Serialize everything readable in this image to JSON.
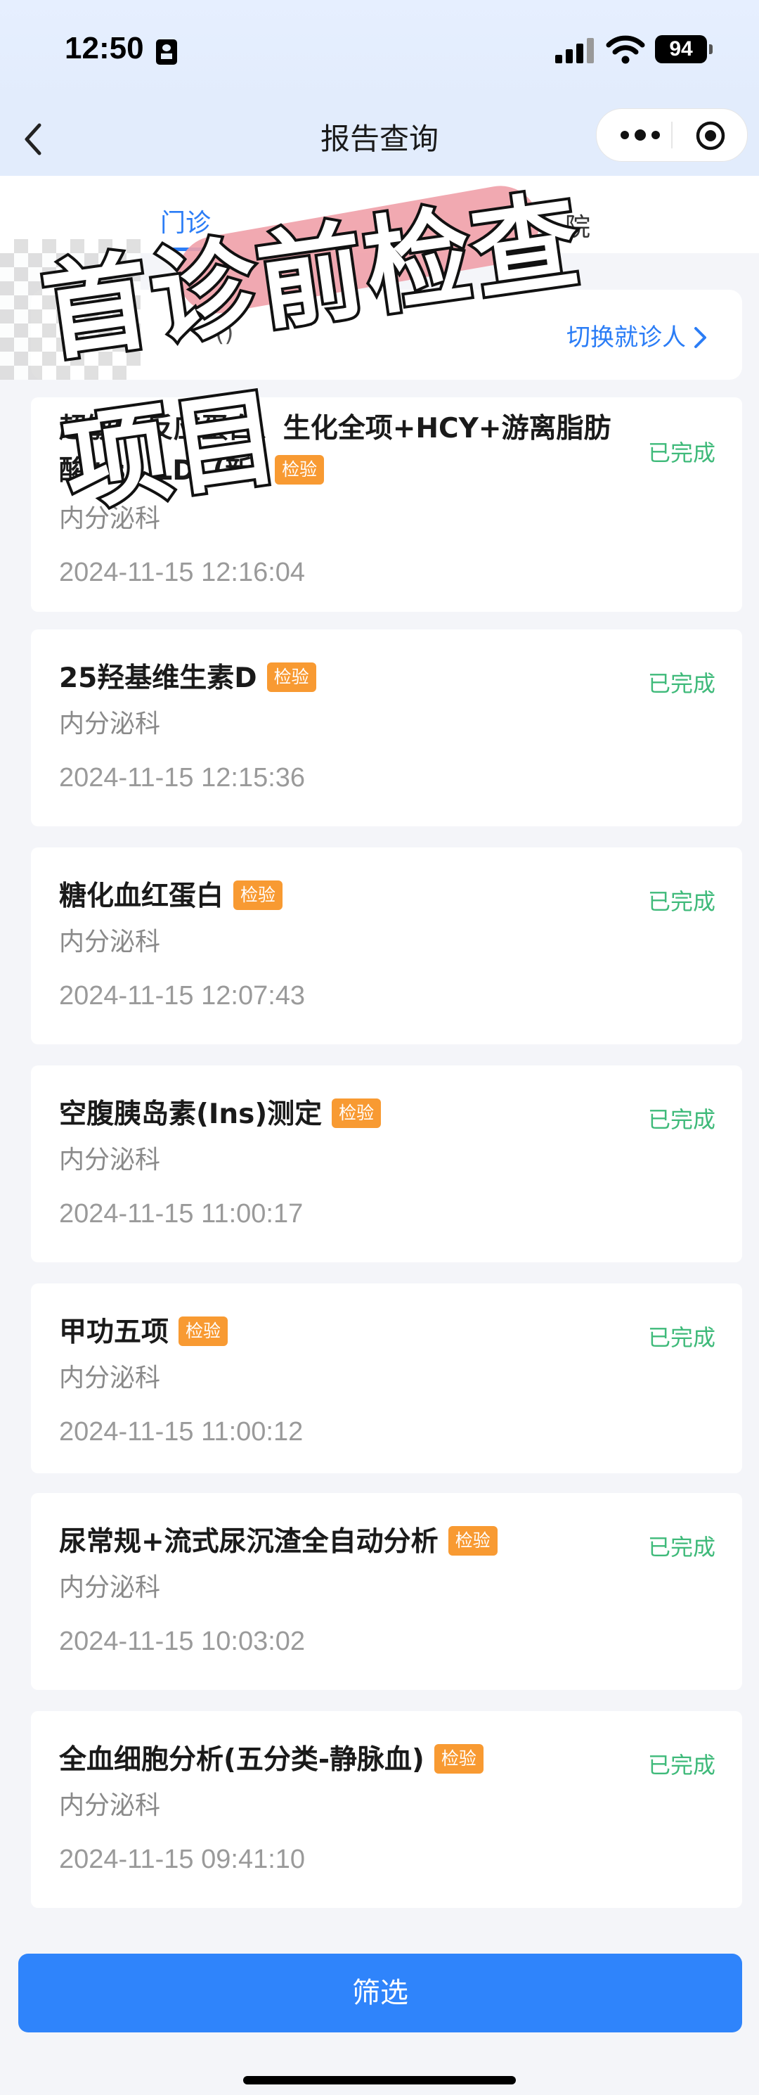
{
  "status_bar": {
    "time": "12:50",
    "battery": "94"
  },
  "nav": {
    "title": "报告查询"
  },
  "tabs": [
    {
      "label": "门诊"
    },
    {
      "label": "院"
    }
  ],
  "patient": {
    "name": "()",
    "switch_label": "切换就诊人"
  },
  "overlay_text": "首诊前检查项目",
  "reports": [
    {
      "title": "超敏C-反应蛋白、生化全项+HCY+游离脂肪酸+sd LDL(新)",
      "tag": "检验",
      "dept": "内分泌科",
      "time": "2024-11-15 12:16:04",
      "status": "已完成"
    },
    {
      "title": "25羟基维生素D",
      "tag": "检验",
      "dept": "内分泌科",
      "time": "2024-11-15 12:15:36",
      "status": "已完成"
    },
    {
      "title": "糖化血红蛋白",
      "tag": "检验",
      "dept": "内分泌科",
      "time": "2024-11-15 12:07:43",
      "status": "已完成"
    },
    {
      "title": "空腹胰岛素(Ins)测定",
      "tag": "检验",
      "dept": "内分泌科",
      "time": "2024-11-15 11:00:17",
      "status": "已完成"
    },
    {
      "title": "甲功五项",
      "tag": "检验",
      "dept": "内分泌科",
      "time": "2024-11-15 11:00:12",
      "status": "已完成"
    },
    {
      "title": "尿常规+流式尿沉渣全自动分析",
      "tag": "检验",
      "dept": "内分泌科",
      "time": "2024-11-15 10:03:02",
      "status": "已完成"
    },
    {
      "title": "全血细胞分析(五分类-静脉血)",
      "tag": "检验",
      "dept": "内分泌科",
      "time": "2024-11-15 09:41:10",
      "status": "已完成"
    }
  ],
  "filter_label": "筛选",
  "colors": {
    "primary": "#2f84fb",
    "tag": "#f89a32",
    "status": "#3fba7a"
  }
}
